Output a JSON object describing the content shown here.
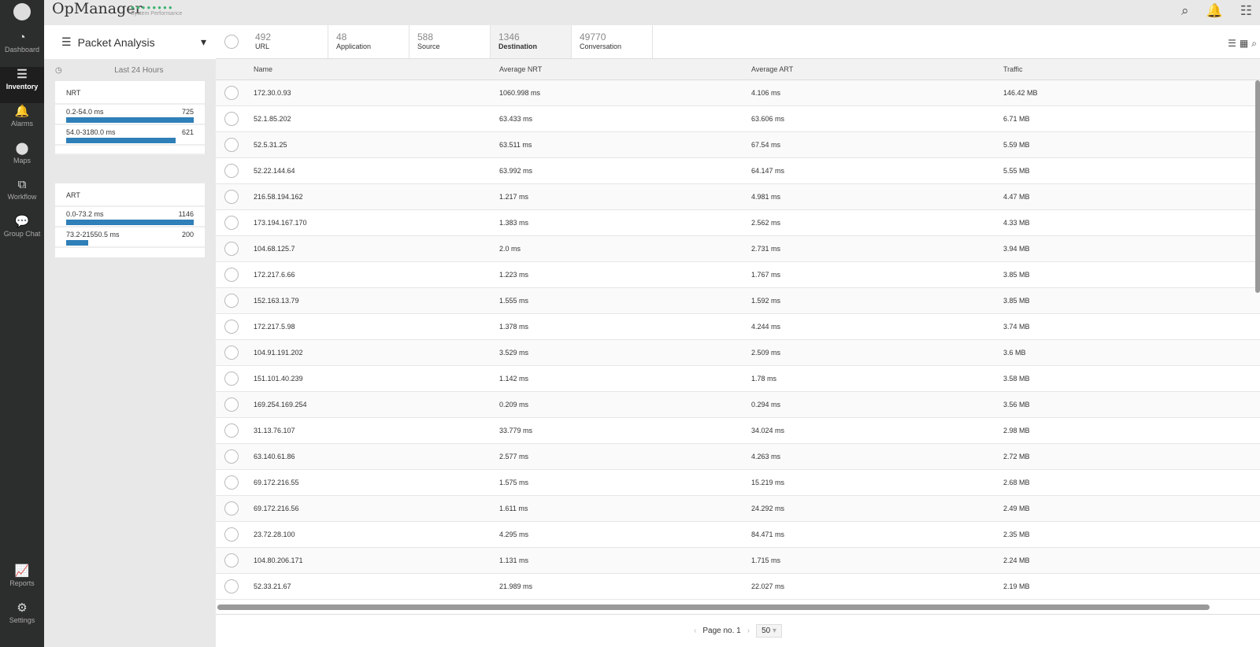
{
  "app": {
    "title": "OpMonitor",
    "perf_label": "System Performance"
  },
  "sidebar": {
    "items": [
      {
        "label": "Dashboard",
        "icon": "◔"
      },
      {
        "label": "Inventory",
        "icon": "☰"
      },
      {
        "label": "Alarms",
        "icon": "🔔"
      },
      {
        "label": "Maps",
        "icon": "⬤"
      },
      {
        "label": "Workflow",
        "icon": "⧉"
      },
      {
        "label": "Group Chat",
        "icon": "💬"
      },
      {
        "label": "Reports",
        "icon": "📈"
      },
      {
        "label": "Settings",
        "icon": "⚙"
      }
    ]
  },
  "panel": {
    "title": "Packet Analysis",
    "period": "Last 24 Hours",
    "nrt": {
      "title": "NRT",
      "rows": [
        {
          "range": "0.2-54.0 ms",
          "count": "725",
          "pct": 100
        },
        {
          "range": "54.0-3180.0 ms",
          "count": "621",
          "pct": 86
        }
      ]
    },
    "art": {
      "title": "ART",
      "rows": [
        {
          "range": "0.0-73.2 ms",
          "count": "1146",
          "pct": 100
        },
        {
          "range": "73.2-21550.5 ms",
          "count": "200",
          "pct": 17
        }
      ]
    }
  },
  "tabs": [
    {
      "count": "492",
      "label": "URL"
    },
    {
      "count": "48",
      "label": "Application"
    },
    {
      "count": "588",
      "label": "Source"
    },
    {
      "count": "1346",
      "label": "Destination"
    },
    {
      "count": "49770",
      "label": "Conversation"
    }
  ],
  "table": {
    "headers": [
      "Name",
      "Average NRT",
      "Average ART",
      "Traffic"
    ],
    "rows": [
      [
        "172.30.0.93",
        "1060.998 ms",
        "4.106 ms",
        "146.42 MB"
      ],
      [
        "52.1.85.202",
        "63.433 ms",
        "63.606 ms",
        "6.71 MB"
      ],
      [
        "52.5.31.25",
        "63.511 ms",
        "67.54 ms",
        "5.59 MB"
      ],
      [
        "52.22.144.64",
        "63.992 ms",
        "64.147 ms",
        "5.55 MB"
      ],
      [
        "216.58.194.162",
        "1.217 ms",
        "4.981 ms",
        "4.47 MB"
      ],
      [
        "173.194.167.170",
        "1.383 ms",
        "2.562 ms",
        "4.33 MB"
      ],
      [
        "104.68.125.7",
        "2.0 ms",
        "2.731 ms",
        "3.94 MB"
      ],
      [
        "172.217.6.66",
        "1.223 ms",
        "1.767 ms",
        "3.85 MB"
      ],
      [
        "152.163.13.79",
        "1.555 ms",
        "1.592 ms",
        "3.85 MB"
      ],
      [
        "172.217.5.98",
        "1.378 ms",
        "4.244 ms",
        "3.74 MB"
      ],
      [
        "104.91.191.202",
        "3.529 ms",
        "2.509 ms",
        "3.6 MB"
      ],
      [
        "151.101.40.239",
        "1.142 ms",
        "1.78 ms",
        "3.58 MB"
      ],
      [
        "169.254.169.254",
        "0.209 ms",
        "0.294 ms",
        "3.56 MB"
      ],
      [
        "31.13.76.107",
        "33.779 ms",
        "34.024 ms",
        "2.98 MB"
      ],
      [
        "63.140.61.86",
        "2.577 ms",
        "4.263 ms",
        "2.72 MB"
      ],
      [
        "69.172.216.55",
        "1.575 ms",
        "15.219 ms",
        "2.68 MB"
      ],
      [
        "69.172.216.56",
        "1.611 ms",
        "24.292 ms",
        "2.49 MB"
      ],
      [
        "23.72.28.100",
        "4.295 ms",
        "84.471 ms",
        "2.35 MB"
      ],
      [
        "104.80.206.171",
        "1.131 ms",
        "1.715 ms",
        "2.24 MB"
      ],
      [
        "52.33.21.67",
        "21.989 ms",
        "22.027 ms",
        "2.19 MB"
      ]
    ]
  },
  "pagination": {
    "page_label": "Page no. 1",
    "page_size": "50"
  }
}
